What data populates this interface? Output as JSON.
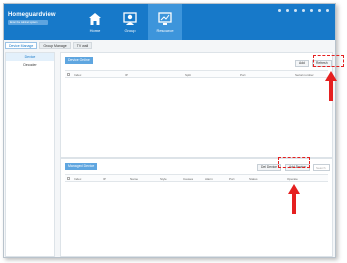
{
  "app": {
    "brand_name": "Homeguardview",
    "brand_sub": "Enter the cabinet system"
  },
  "nav": [
    {
      "label": "Home",
      "icon": "home-icon"
    },
    {
      "label": "Group",
      "icon": "group-icon"
    },
    {
      "label": "Resource",
      "icon": "resource-icon"
    }
  ],
  "tabs": [
    "Device Manage",
    "Group Manage",
    "TV wall"
  ],
  "sidebar": [
    "Device",
    "Decoder"
  ],
  "online_panel": {
    "title": "Device Online",
    "add_label": "Add",
    "refresh_label": "Refresh",
    "columns": [
      "Index",
      "IP",
      "Split",
      "Port",
      "Serial number"
    ]
  },
  "managed_panel": {
    "title": "Managed Device",
    "del_label": "Del Device",
    "add_label": "Add Device",
    "search_placeholder": "Search",
    "columns": [
      "Index",
      "IP",
      "Name",
      "Style",
      "Causes",
      "Alarm",
      "Port",
      "Status",
      "Operate"
    ]
  },
  "colors": {
    "header": "#1779c9",
    "highlight": "#e52020"
  }
}
